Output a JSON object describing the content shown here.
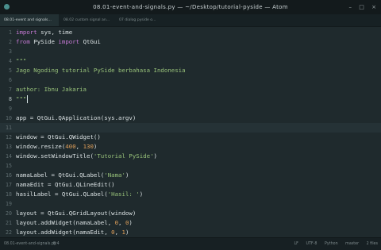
{
  "window": {
    "title": "08.01-event-and-signals.py — ~/Desktop/tutorial-pyside — Atom",
    "minimize": "–",
    "maximize": "□",
    "close": "×"
  },
  "tabs": [
    {
      "label": "08.01-event and signals..."
    },
    {
      "label": "08.02 custom signal an..."
    },
    {
      "label": "07 dialog pyside o..."
    }
  ],
  "line_numbers": [
    "1",
    "2",
    "3",
    "4",
    "5",
    "6",
    "7",
    "8",
    "9",
    "10",
    "11",
    "12",
    "13",
    "14",
    "15",
    "16",
    "17",
    "18",
    "19",
    "20",
    "21",
    "22"
  ],
  "code": {
    "l1": {
      "kw": "import",
      "rest": " sys, time"
    },
    "l2": {
      "kw1": "from",
      "mid": " PySide ",
      "kw2": "import",
      "rest": " QtGui"
    },
    "l4": "\"\"\"",
    "l5": "Jago Ngoding tutorial PySide berbahasa Indonesia",
    "l7": "author: Ibnu Jakaria",
    "l8": "\"\"\"",
    "l10": "app = QtGui.QApplication(sys.argv)",
    "l12": "window = QtGui.QWidget()",
    "l13": {
      "pre": "window.resize(",
      "n1": "400",
      "mid": ", ",
      "n2": "130",
      "post": ")"
    },
    "l14": {
      "pre": "window.setWindowTitle(",
      "str": "'Tutorial PySide'",
      "post": ")"
    },
    "l16": {
      "pre": "namaLabel = QtGui.QLabel(",
      "str": "'Nama'",
      "post": ")"
    },
    "l17": "namaEdit = QtGui.QLineEdit()",
    "l18": {
      "pre": "hasilLabel = QtGui.QLabel(",
      "str": "'Hasil: '",
      "post": ")"
    },
    "l20": "layout = QtGui.QGridLayout(window)",
    "l21": {
      "pre": "layout.addWidget(namaLabel, ",
      "n1": "0",
      "mid": ", ",
      "n2": "0",
      "post": ")"
    },
    "l22": {
      "pre": "layout.addWidget(namaEdit, ",
      "n1": "0",
      "mid": ", ",
      "n2": "1",
      "post": ")"
    }
  },
  "status": {
    "file": "08.01-event-and-signals.py",
    "position": "8:4",
    "line_ending": "LF",
    "encoding": "UTF-8",
    "grammar": "Python",
    "branch": "master",
    "updates": "2 files"
  },
  "colors": {
    "background": "#1f2a2d",
    "keyword": "#c77ad6",
    "string": "#98c27a",
    "number": "#e1a05a"
  }
}
